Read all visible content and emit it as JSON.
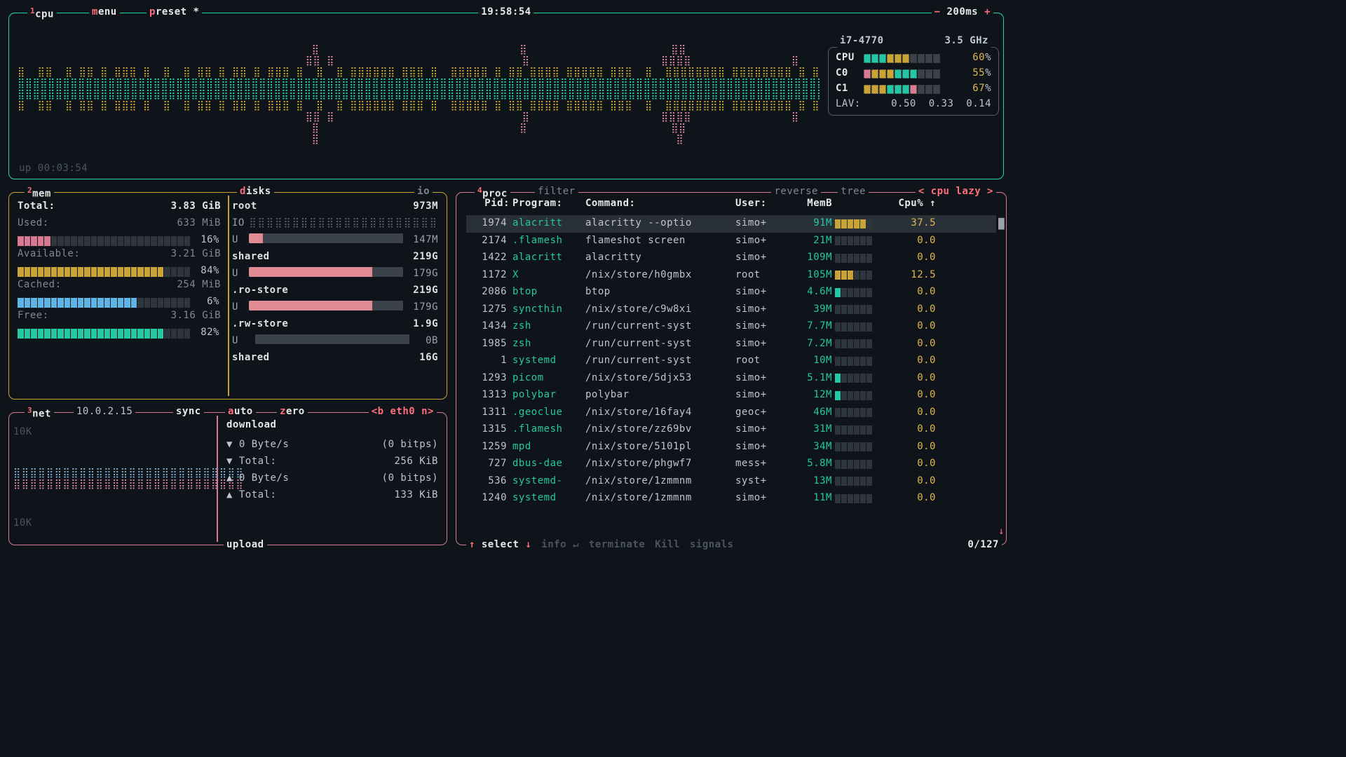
{
  "header": {
    "tabs": {
      "cpu_num": "1",
      "cpu": "cpu",
      "menu_k": "m",
      "menu": "enu",
      "preset_k": "p",
      "preset": "reset *"
    },
    "clock": "19:58:54",
    "refresh": {
      "minus": "−",
      "value": "200ms",
      "plus": "+"
    }
  },
  "cpu": {
    "model": "i7-4770",
    "freq": "3.5 GHz",
    "uptime": "up 00:03:54",
    "rows": [
      {
        "label": "CPU",
        "pct": "60",
        "bar": [
          "teal",
          "teal",
          "teal",
          "yellow",
          "yellow",
          "yellow",
          "grey",
          "grey",
          "grey",
          "grey"
        ]
      },
      {
        "label": "C0",
        "pct": "55",
        "bar": [
          "pink",
          "yellow",
          "yellow",
          "yellow",
          "teal",
          "teal",
          "teal",
          "grey",
          "grey",
          "grey"
        ]
      },
      {
        "label": "C1",
        "pct": "67",
        "bar": [
          "yellow",
          "yellow",
          "yellow",
          "teal",
          "teal",
          "teal",
          "pink",
          "grey",
          "grey",
          "grey"
        ]
      }
    ],
    "lav": [
      "0.50",
      "0.33",
      "0.14"
    ]
  },
  "mem": {
    "title_num": "2",
    "title": "mem",
    "total": {
      "label": "Total:",
      "value": "3.83 GiB"
    },
    "used": {
      "label": "Used:",
      "value": "633 MiB",
      "pct": "16%",
      "bar_color": "pink",
      "fill": 5
    },
    "avail": {
      "label": "Available:",
      "value": "3.21 GiB",
      "pct": "84%",
      "bar_color": "yellow",
      "fill": 22
    },
    "cached": {
      "label": "Cached:",
      "value": "254 MiB",
      "pct": "6%",
      "bar_color": "blue",
      "fill": 18
    },
    "free": {
      "label": "Free:",
      "value": "3.16 GiB",
      "pct": "82%",
      "bar_color": "teal",
      "fill": 22
    },
    "disks_title": "disks",
    "io_title": "io",
    "disks": [
      {
        "name": "root",
        "size": "973M",
        "io": "IO",
        "io_bar": "⣿⣿⣿⣿⣿⣿⣿⣿⣿⣿⣿⣿⣿⣿⣿⣿⣿⣿⣿⣿⣿⣿",
        "u": "U",
        "used": "147M",
        "fill": 9
      },
      {
        "name": "shared",
        "size": "219G",
        "u": "U",
        "used": "179G",
        "fill": 80
      },
      {
        "name": ".ro-store",
        "size": "219G",
        "u": "U",
        "used": "179G",
        "fill": 80
      },
      {
        "name": ".rw-store",
        "size": "1.9G",
        "u": "U",
        "used": "0B",
        "fill": 0
      },
      {
        "name": "shared",
        "size": "16G"
      }
    ]
  },
  "net": {
    "title_num": "3",
    "title": "net",
    "ip": "10.0.2.15",
    "sync": "sync",
    "auto": "auto",
    "zero_k": "z",
    "zero": "ero",
    "iface": "<b eth0 n>",
    "scale_top": "10K",
    "scale_bot": "10K",
    "download_title": "download",
    "upload_title": "upload",
    "down_rate": "0 Byte/s",
    "down_bits": "(0 bitps)",
    "down_total_label": "Total:",
    "down_total": "256 KiB",
    "up_rate": "0 Byte/s",
    "up_bits": "(0 bitps)",
    "up_total_label": "Total:",
    "up_total": "133 KiB"
  },
  "proc": {
    "title_num": "4",
    "title": "proc",
    "filter": "filter",
    "reverse": "reverse",
    "tree": "tree",
    "sort": "< cpu lazy >",
    "headers": {
      "pid": "Pid:",
      "program": "Program:",
      "command": "Command:",
      "user": "User:",
      "mem": "MemB",
      "cpu": "Cpu% ↑"
    },
    "rows": [
      {
        "pid": "1974",
        "prog": "alacritt",
        "cmd": "alacritty --optio",
        "usr": "simo+",
        "mem": "91M",
        "bar": 5,
        "cpu": "37.5",
        "sel": true
      },
      {
        "pid": "2174",
        "prog": ".flamesh",
        "cmd": "flameshot screen",
        "usr": "simo+",
        "mem": "21M",
        "bar": 0,
        "cpu": "0.0"
      },
      {
        "pid": "1422",
        "prog": "alacritt",
        "cmd": "alacritty",
        "usr": "simo+",
        "mem": "109M",
        "bar": 0,
        "cpu": "0.0"
      },
      {
        "pid": "1172",
        "prog": "X",
        "cmd": "/nix/store/h0gmbx",
        "usr": "root",
        "mem": "105M",
        "bar": 3,
        "cpu": "12.5"
      },
      {
        "pid": "2086",
        "prog": "btop",
        "cmd": "btop",
        "usr": "simo+",
        "mem": "4.6M",
        "bar": 1,
        "barcolor": "teal",
        "cpu": "0.0"
      },
      {
        "pid": "1275",
        "prog": "syncthin",
        "cmd": "/nix/store/c9w8xi",
        "usr": "simo+",
        "mem": "39M",
        "bar": 0,
        "cpu": "0.0"
      },
      {
        "pid": "1434",
        "prog": "zsh",
        "cmd": "/run/current-syst",
        "usr": "simo+",
        "mem": "7.7M",
        "bar": 0,
        "cpu": "0.0"
      },
      {
        "pid": "1985",
        "prog": "zsh",
        "cmd": "/run/current-syst",
        "usr": "simo+",
        "mem": "7.2M",
        "bar": 0,
        "cpu": "0.0"
      },
      {
        "pid": "1",
        "prog": "systemd",
        "cmd": "/run/current-syst",
        "usr": "root",
        "mem": "10M",
        "bar": 0,
        "cpu": "0.0"
      },
      {
        "pid": "1293",
        "prog": "picom",
        "cmd": "/nix/store/5djx53",
        "usr": "simo+",
        "mem": "5.1M",
        "bar": 1,
        "barcolor": "teal",
        "cpu": "0.0"
      },
      {
        "pid": "1313",
        "prog": "polybar",
        "cmd": "polybar",
        "usr": "simo+",
        "mem": "12M",
        "bar": 1,
        "barcolor": "teal",
        "cpu": "0.0"
      },
      {
        "pid": "1311",
        "prog": ".geoclue",
        "cmd": "/nix/store/16fay4",
        "usr": "geoc+",
        "mem": "46M",
        "bar": 0,
        "cpu": "0.0"
      },
      {
        "pid": "1315",
        "prog": ".flamesh",
        "cmd": "/nix/store/zz69bv",
        "usr": "simo+",
        "mem": "31M",
        "bar": 0,
        "cpu": "0.0"
      },
      {
        "pid": "1259",
        "prog": "mpd",
        "cmd": "/nix/store/5101pl",
        "usr": "simo+",
        "mem": "34M",
        "bar": 0,
        "cpu": "0.0"
      },
      {
        "pid": "727",
        "prog": "dbus-dae",
        "cmd": "/nix/store/phgwf7",
        "usr": "mess+",
        "mem": "5.8M",
        "bar": 0,
        "cpu": "0.0"
      },
      {
        "pid": "536",
        "prog": "systemd-",
        "cmd": "/nix/store/1zmmnm",
        "usr": "syst+",
        "mem": "13M",
        "bar": 0,
        "cpu": "0.0"
      },
      {
        "pid": "1240",
        "prog": "systemd",
        "cmd": "/nix/store/1zmmnm",
        "usr": "simo+",
        "mem": "11M",
        "bar": 0,
        "cpu": "0.0"
      }
    ],
    "footer": {
      "select": "select",
      "info": "info",
      "enter": "↵",
      "terminate": "terminate",
      "kill": "Kill",
      "signals": "signals",
      "page": "0/127",
      "down": "↓",
      "up": "↑"
    }
  }
}
